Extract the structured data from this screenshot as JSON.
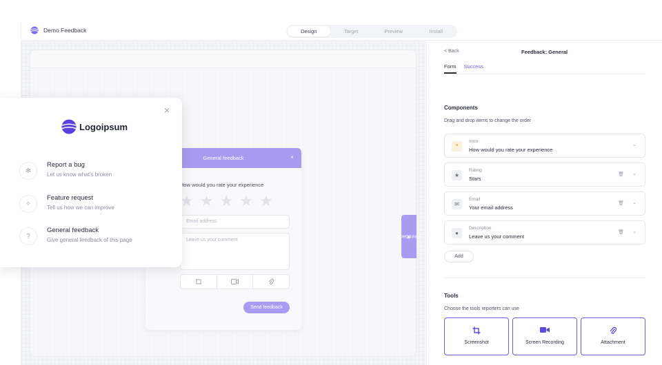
{
  "app": {
    "name": "Demo Feedback",
    "steps": [
      "Design",
      "Target",
      "Preview",
      "Install"
    ],
    "active_step": "Design"
  },
  "popup": {
    "logo_text": "Logoipsum",
    "close_glyph": "×",
    "items": [
      {
        "title": "Report a bug",
        "subtitle": "Let us know what's broken",
        "icon": "bug-icon"
      },
      {
        "title": "Feature request",
        "subtitle": "Tell us how we can improve",
        "icon": "sparkle-icon"
      },
      {
        "title": "General feedback",
        "subtitle": "Give general feedback of this page",
        "icon": "question-icon"
      }
    ]
  },
  "widget": {
    "title": "General feedback",
    "close_glyph": "×",
    "question": "How would you rate your experience",
    "star_count": 5,
    "email_placeholder": "Email address",
    "comment_placeholder": "Leave us your comment",
    "send_label": "Send feedback",
    "tools_icons": [
      "screenshot-icon",
      "video-icon",
      "attachment-icon"
    ]
  },
  "side_tab": {
    "label": "Feedback"
  },
  "panel": {
    "back_label": "< Back",
    "title": "Feedback: General",
    "tabs": [
      "Form",
      "Success"
    ],
    "active_tab": "Form",
    "components_title": "Components",
    "components_subtitle": "Drag and drop items to change the order",
    "components": [
      {
        "label": "Intro",
        "value": "How would you rate your experience",
        "icon": "quote-icon",
        "icon_color": "#f2a23a",
        "icon_bg": "#fdf0dc",
        "deletable": false
      },
      {
        "label": "Rating",
        "value": "Stars",
        "icon": "star-icon",
        "icon_color": "#6b6f7c",
        "icon_bg": "#eef0f4",
        "deletable": true
      },
      {
        "label": "Email",
        "value": "Your email address",
        "icon": "mail-icon",
        "icon_color": "#6b6f7c",
        "icon_bg": "#eef0f4",
        "deletable": true
      },
      {
        "label": "Description",
        "value": "Leave us your comment",
        "icon": "comment-icon",
        "icon_color": "#6b6f7c",
        "icon_bg": "#eef0f4",
        "deletable": true
      }
    ],
    "add_label": "Add",
    "tools_title": "Tools",
    "tools_subtitle": "Choose the tools reporters can use",
    "tools": [
      {
        "label": "Screenshot",
        "icon": "crop-icon"
      },
      {
        "label": "Screen Recording",
        "icon": "video-camera-icon"
      },
      {
        "label": "Attachment",
        "icon": "paperclip-icon"
      }
    ]
  },
  "colors": {
    "accent": "#a99bf2",
    "accent_strong": "#6a5ce0",
    "text": "#2a2d3a"
  }
}
